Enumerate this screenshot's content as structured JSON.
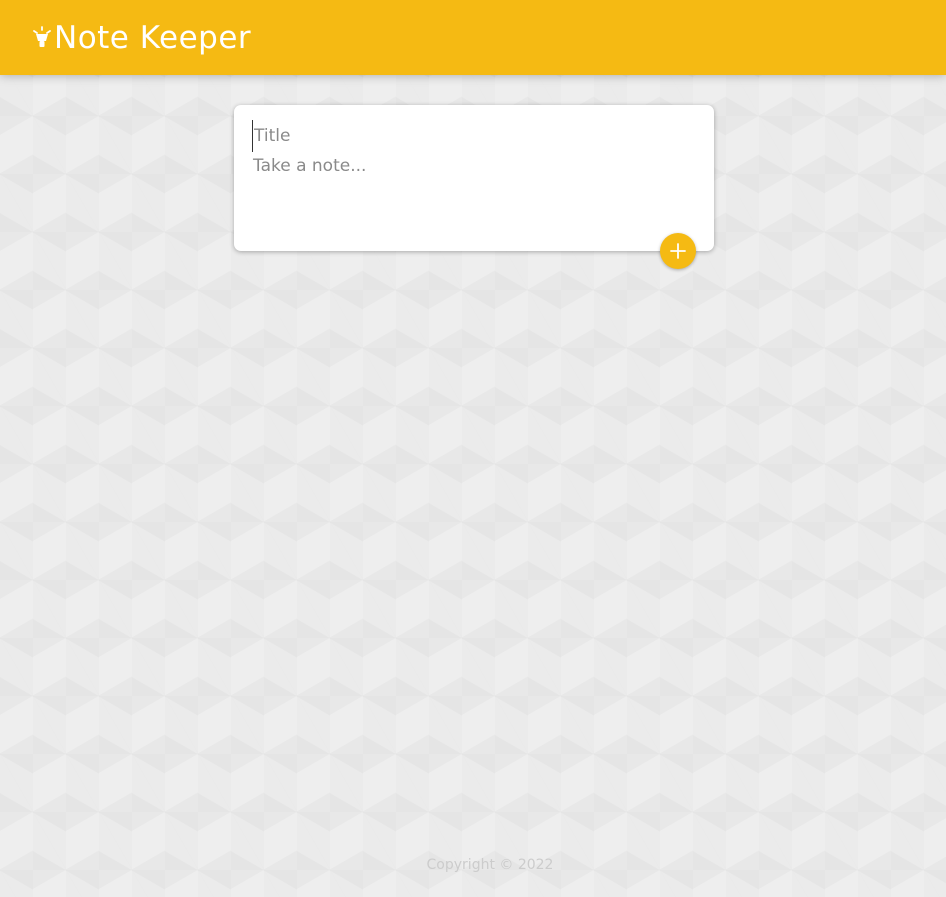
{
  "header": {
    "app_title": "Note Keeper",
    "logo_icon": "lightbulb-icon",
    "background_color": "#f5ba13"
  },
  "note_form": {
    "title_placeholder": "Title",
    "title_value": "",
    "content_placeholder": "Take a note...",
    "content_value": "",
    "add_button_icon": "plus-icon"
  },
  "footer": {
    "copyright": "Copyright © 2022"
  },
  "colors": {
    "accent": "#f5ba13",
    "background": "#eeeeee",
    "footer_text": "#cccccc"
  }
}
